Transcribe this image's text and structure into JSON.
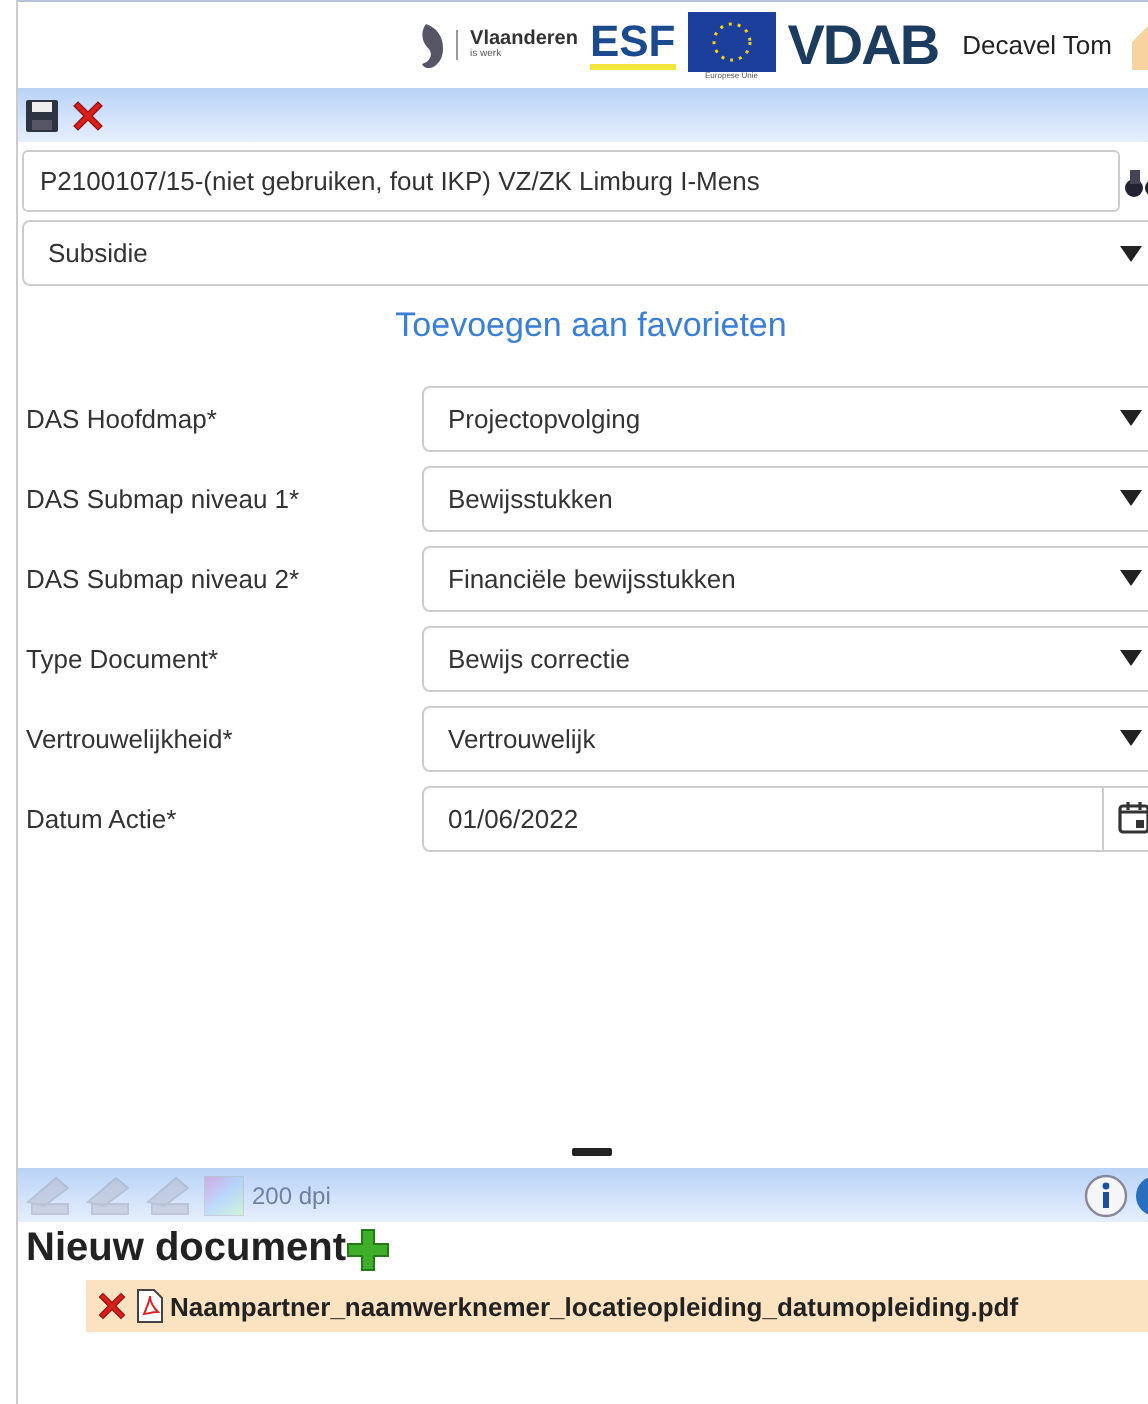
{
  "header": {
    "logo_texts": {
      "vlaanderen": "Vlaanderen",
      "vlaanderen_sub": "is werk",
      "esf": "ESF",
      "eu": "Europese Unie",
      "vdab": "VDAB"
    },
    "user": "Decavel Tom"
  },
  "project": {
    "value": "P2100107/15-(niet gebruiken, fout IKP) VZ/ZK Limburg I-Mens"
  },
  "category": {
    "value": "Subsidie"
  },
  "favorite_link": "Toevoegen aan favorieten",
  "fields": [
    {
      "label": "DAS Hoofdmap*",
      "value": "Projectopvolging",
      "kind": "select"
    },
    {
      "label": "DAS Submap niveau 1*",
      "value": "Bewijsstukken",
      "kind": "select"
    },
    {
      "label": "DAS Submap niveau 2*",
      "value": "Financiële bewijsstukken",
      "kind": "select"
    },
    {
      "label": "Type Document*",
      "value": "Bewijs correctie",
      "kind": "select"
    },
    {
      "label": "Vertrouwelijkheid*",
      "value": "Vertrouwelijk",
      "kind": "select"
    },
    {
      "label": "Datum Actie*",
      "value": "01/06/2022",
      "kind": "date"
    }
  ],
  "scanner": {
    "disabled": true,
    "resolution": "200 dpi"
  },
  "documents": {
    "title": "Nieuw document",
    "files": [
      {
        "name": "Naampartner_naamwerknemer_locatieopleiding_datumopleiding.pdf"
      }
    ]
  }
}
